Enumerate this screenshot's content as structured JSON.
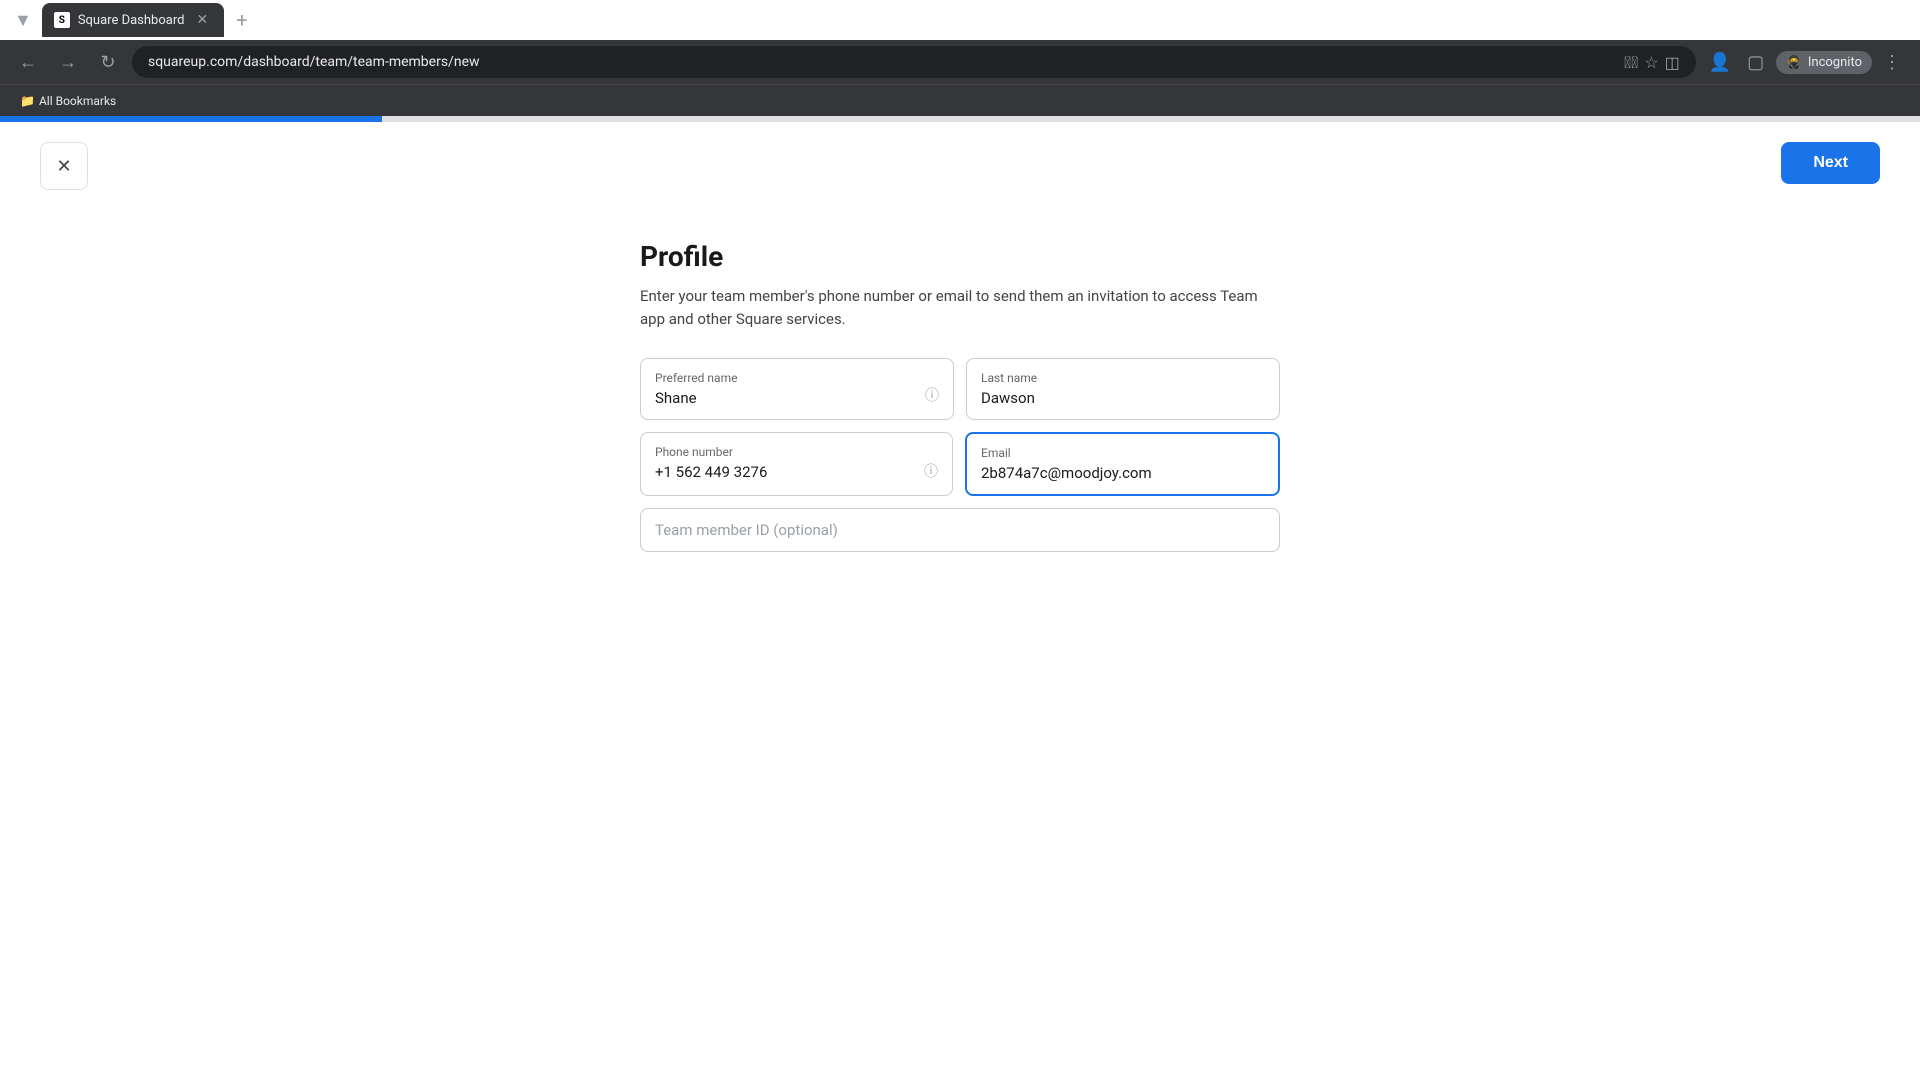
{
  "browser": {
    "tab_title": "Square Dashboard",
    "url": "squareup.com/dashboard/team/team-members/new",
    "incognito_label": "Incognito",
    "bookmarks_label": "All Bookmarks"
  },
  "progress": {
    "segments": [
      {
        "color": "#1a73e8",
        "active": true
      },
      {
        "color": "#e0e0e0",
        "active": false
      },
      {
        "color": "#e0e0e0",
        "active": false
      },
      {
        "color": "#e0e0e0",
        "active": false
      },
      {
        "color": "#e0e0e0",
        "active": false
      }
    ]
  },
  "buttons": {
    "close_label": "✕",
    "next_label": "Next"
  },
  "form": {
    "title": "Profile",
    "description": "Enter your team member's phone number or email to send them an invitation to access Team app and other Square services.",
    "fields": {
      "preferred_name_label": "Preferred name",
      "preferred_name_value": "Shane",
      "last_name_label": "Last name",
      "last_name_value": "Dawson",
      "phone_label": "Phone number",
      "phone_value": "+1 562 449 3276",
      "email_label": "Email",
      "email_value": "2b874a7c@moodjoy.com",
      "team_member_id_placeholder": "Team member ID (optional)"
    }
  }
}
